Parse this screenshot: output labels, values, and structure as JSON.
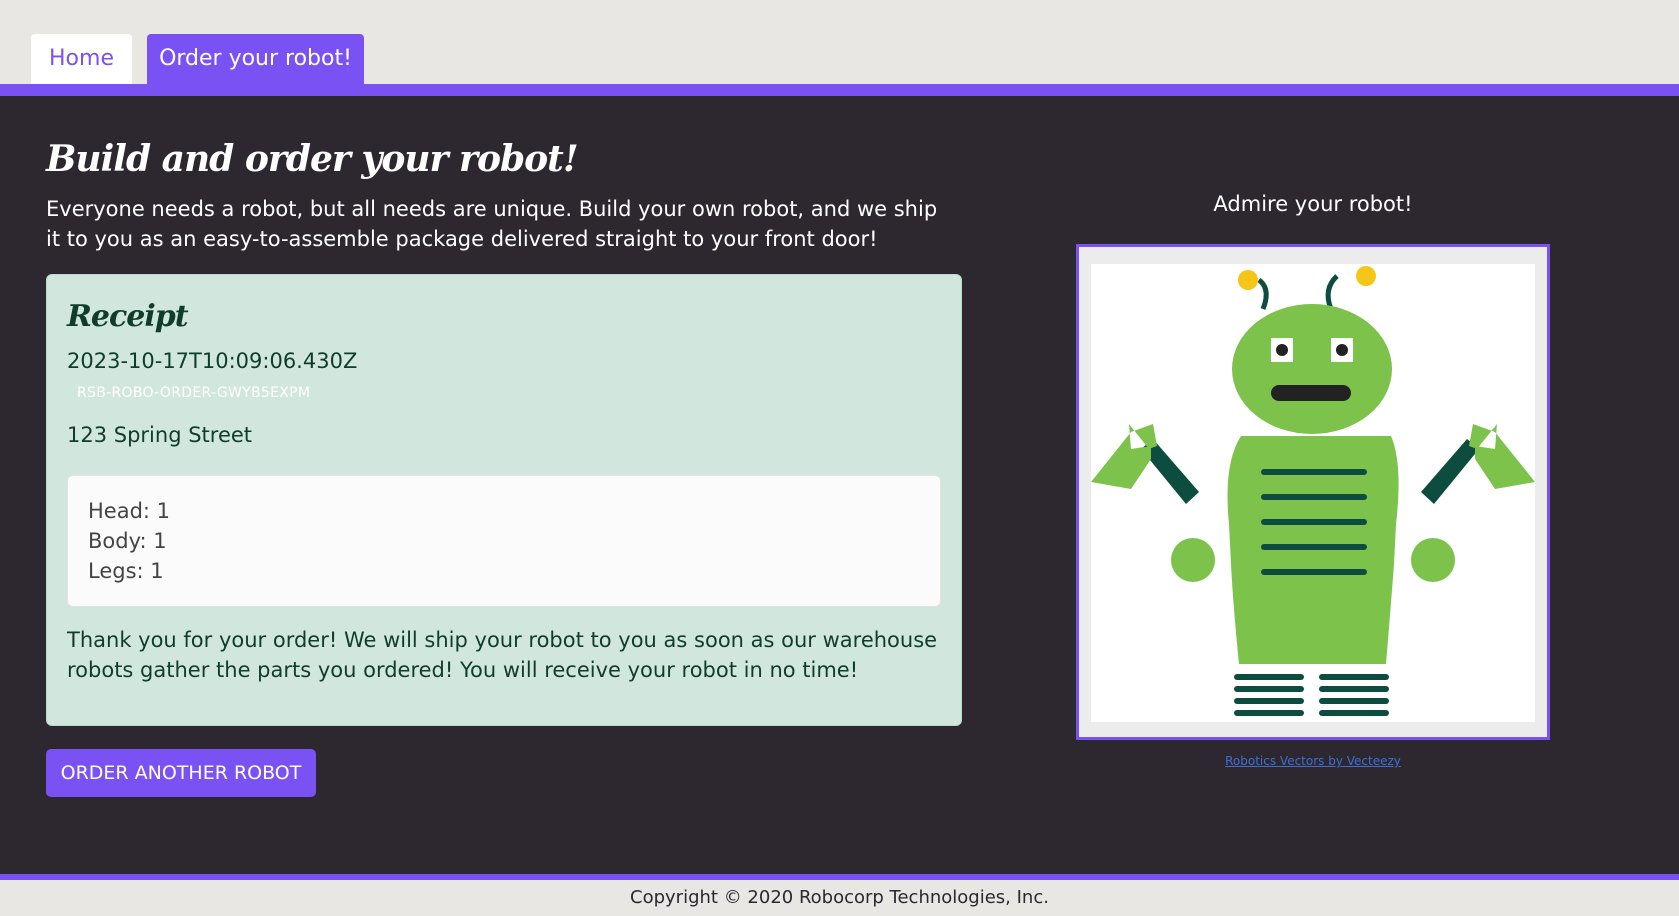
{
  "nav": {
    "tabs": [
      {
        "label": "Home",
        "active": false
      },
      {
        "label": "Order your robot!",
        "active": true
      }
    ]
  },
  "main": {
    "title": "Build and order your robot!",
    "intro": "Everyone needs a robot, but all needs are unique. Build your own robot, and we ship it to you as an easy-to-assemble package delivered straight to your front door!"
  },
  "receipt": {
    "title": "Receipt",
    "timestamp": "2023-10-17T10:09:06.430Z",
    "order_id": "RSB-ROBO-ORDER-GWYB5EXPM",
    "address": "123 Spring Street",
    "parts": [
      "Head: 1",
      "Body: 1",
      "Legs: 1"
    ],
    "thanks": "Thank you for your order! We will ship your robot to you as soon as our warehouse robots gather the parts you ordered! You will receive your robot in no time!"
  },
  "actions": {
    "order_another_label": "ORDER ANOTHER ROBOT"
  },
  "preview": {
    "heading": "Admire your robot!",
    "credit": "Robotics Vectors by Vecteezy",
    "image_icon": "robot-icon"
  },
  "footer": {
    "copyright": "Copyright © 2020 Robocorp Technologies, Inc."
  },
  "colors": {
    "accent": "#7a52f4",
    "background_dark": "#2d2730",
    "receipt_bg": "#d1e7dd",
    "robot_green": "#7dc24b",
    "robot_dark_green": "#0d4d3f",
    "antenna_yellow": "#f5c518"
  }
}
